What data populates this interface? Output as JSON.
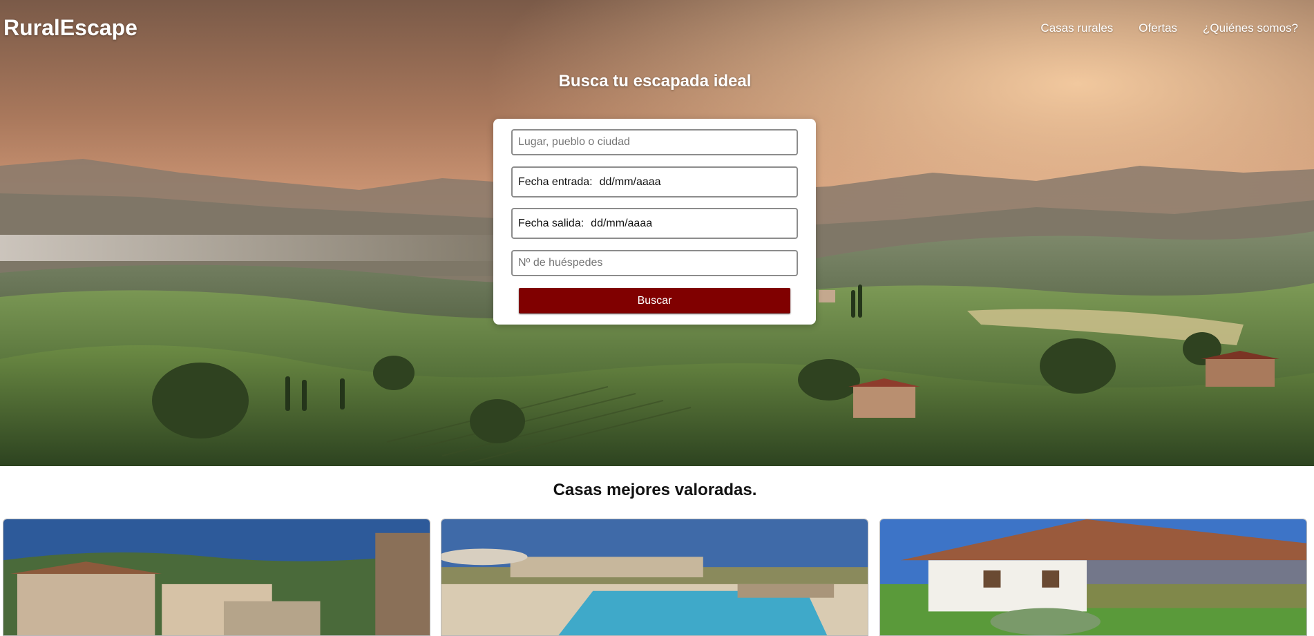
{
  "brand": "RuralEscape",
  "nav": {
    "items": [
      "Casas rurales",
      "Ofertas",
      "¿Quiénes somos?"
    ]
  },
  "hero": {
    "title": "Busca tu escapada ideal"
  },
  "search": {
    "place_placeholder": "Lugar, pueblo o ciudad",
    "checkin_label": "Fecha entrada:",
    "checkin_value": "dd/mm/aaaa",
    "checkout_label": "Fecha salida:",
    "checkout_value": "dd/mm/aaaa",
    "guests_placeholder": "Nº de huéspedes",
    "button_label": "Buscar"
  },
  "top_rated": {
    "title": "Casas mejores valoradas."
  },
  "colors": {
    "accent": "#800000",
    "hero_sky": "#c98d6a"
  }
}
